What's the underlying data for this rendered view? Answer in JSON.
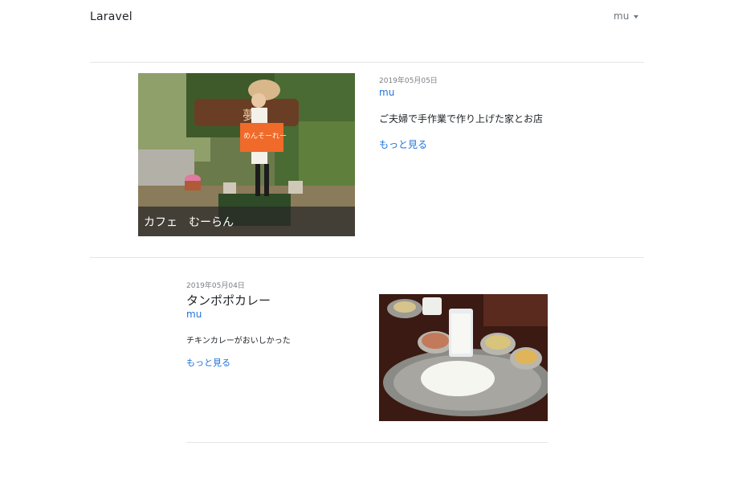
{
  "navbar": {
    "brand": "Laravel",
    "user": "mu"
  },
  "posts": [
    {
      "date": "2019年05月05日",
      "author": "mu",
      "title": "カフェ　むーらん",
      "body": "ご夫婦で手作業で作り上げた家とお店",
      "more": "もっと見る",
      "sign_text": "めんそーれー"
    },
    {
      "date": "2019年05月04日",
      "author": "mu",
      "title": "タンポポカレー",
      "body": "チキンカレーがおいしかった",
      "more": "もっと見る"
    }
  ]
}
